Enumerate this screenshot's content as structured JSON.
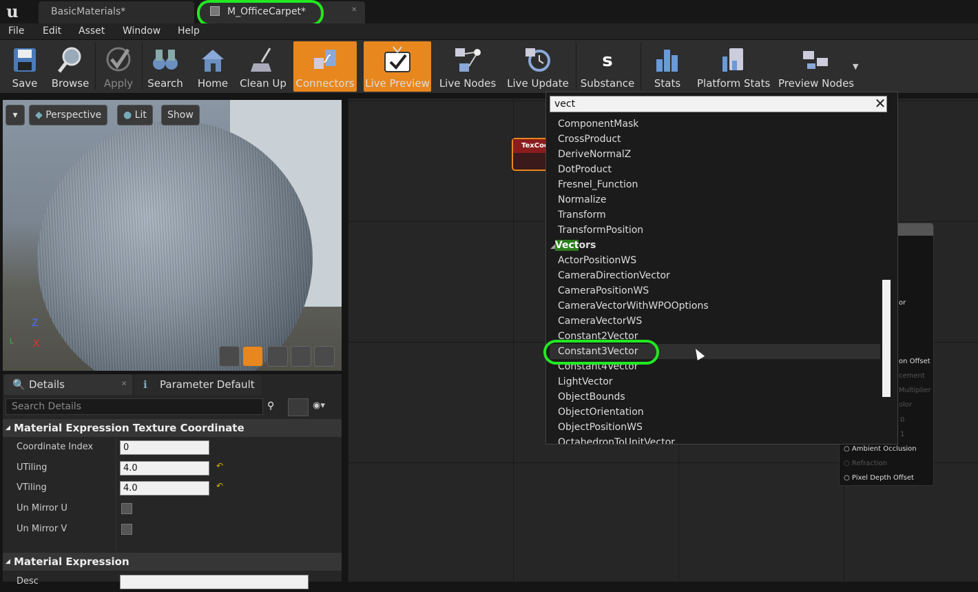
{
  "tabs": [
    {
      "label": "BasicMaterials*"
    },
    {
      "label": "M_OfficeCarpet*"
    }
  ],
  "menu": [
    "File",
    "Edit",
    "Asset",
    "Window",
    "Help"
  ],
  "toolbar": [
    {
      "label": "Save",
      "icon": "save-icon"
    },
    {
      "label": "Browse",
      "icon": "magnifier-icon"
    },
    {
      "label": "Apply",
      "icon": "checkmark-icon"
    },
    {
      "label": "Search",
      "icon": "binoculars-icon"
    },
    {
      "label": "Home",
      "icon": "home-icon"
    },
    {
      "label": "Clean Up",
      "icon": "broom-icon"
    },
    {
      "label": "Connectors",
      "icon": "connectors-icon",
      "active": true
    },
    {
      "label": "Live Preview",
      "icon": "tv-check-icon",
      "active": true
    },
    {
      "label": "Live Nodes",
      "icon": "live-nodes-icon"
    },
    {
      "label": "Live Update",
      "icon": "live-update-icon"
    },
    {
      "label": "Substance",
      "icon": "substance-icon"
    },
    {
      "label": "Stats",
      "icon": "bar-chart-icon"
    },
    {
      "label": "Platform Stats",
      "icon": "platform-stats-icon"
    },
    {
      "label": "Preview Nodes",
      "icon": "preview-nodes-icon"
    }
  ],
  "viewport": {
    "perspective": "Perspective",
    "lit": "Lit",
    "show": "Show",
    "axis_z": "Z",
    "axis_x": "X"
  },
  "details": {
    "tab_details": "Details",
    "tab_params": "Parameter Default",
    "search_placeholder": "Search Details",
    "category1": "Material Expression Texture Coordinate",
    "props": [
      {
        "label": "Coordinate Index",
        "value": "0"
      },
      {
        "label": "UTiling",
        "value": "4.0"
      },
      {
        "label": "VTiling",
        "value": "4.0"
      },
      {
        "label": "Un Mirror U"
      },
      {
        "label": "Un Mirror V"
      }
    ],
    "category2": "Material Expression",
    "desc_label": "Desc"
  },
  "graph": {
    "texnode_title": "TexCoord",
    "matnode_pins": [
      {
        "label": "or",
        "dim": false
      },
      {
        "label": "on Offset",
        "dim": false
      },
      {
        "label": "cement",
        "dim": true
      },
      {
        "label": "Multiplier",
        "dim": true
      },
      {
        "label": "olor",
        "dim": true
      },
      {
        "label": "0",
        "dim": true
      },
      {
        "label": "1",
        "dim": true
      },
      {
        "label": "Ambient Occlusion",
        "dim": false
      },
      {
        "label": "Refraction",
        "dim": true
      },
      {
        "label": "Pixel Depth Offset",
        "dim": false
      }
    ]
  },
  "popup": {
    "search_value": "vect",
    "items": [
      "ComponentMask",
      "CrossProduct",
      "DeriveNormalZ",
      "DotProduct",
      "Fresnel_Function",
      "Normalize",
      "Transform",
      "TransformPosition"
    ],
    "category_match": "Vect",
    "category_rest": "ors",
    "vector_items": [
      "ActorPositionWS",
      "CameraDirectionVector",
      "CameraPositionWS",
      "CameraVectorWithWPOOptions",
      "CameraVectorWS",
      "Constant2Vector",
      "Constant3Vector",
      "Constant4Vector",
      "LightVector",
      "ObjectBounds",
      "ObjectOrientation",
      "ObjectPositionWS",
      "OctahedronToUnitVector"
    ],
    "selected": "Constant3Vector"
  },
  "colors": {
    "accent": "#e8871d",
    "highlight": "#22e822"
  }
}
